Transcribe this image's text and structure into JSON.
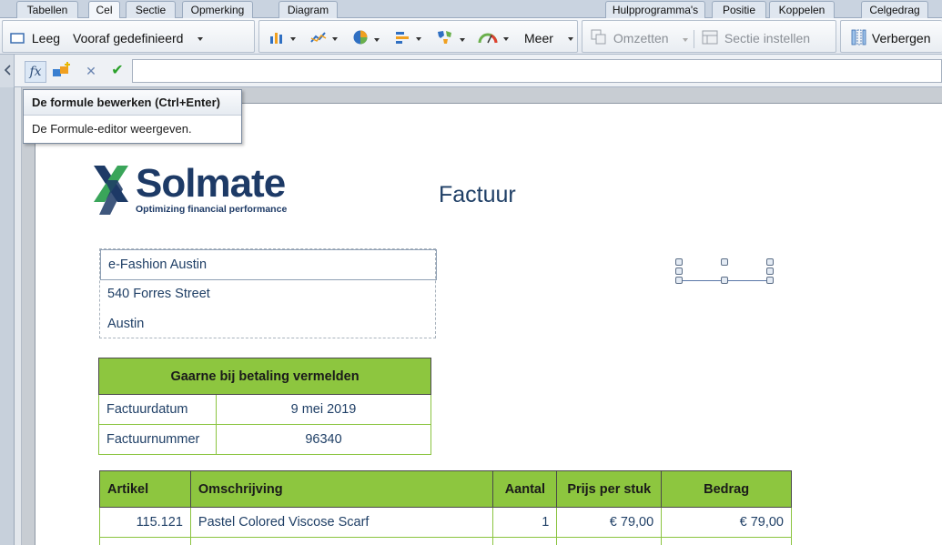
{
  "tabs_left": [
    {
      "label": "Tabellen",
      "active": false
    },
    {
      "label": "Cel",
      "active": true
    },
    {
      "label": "Sectie",
      "active": false
    },
    {
      "label": "Opmerking",
      "active": false
    },
    {
      "label": "Diagram",
      "active": false
    }
  ],
  "tabs_right": [
    {
      "label": "Hulpprogramma's",
      "active": false
    },
    {
      "label": "Positie",
      "active": false
    },
    {
      "label": "Koppelen",
      "active": false
    },
    {
      "label": "Celgedrag",
      "active": false
    }
  ],
  "toolbar": {
    "leeg_label": "Leeg",
    "vooraf_label": "Vooraf gedefinieerd",
    "meer_label": "Meer",
    "omzetten_label": "Omzetten",
    "sectie_label": "Sectie instellen",
    "verbergen_label": "Verbergen"
  },
  "formula_bar": {
    "fx_label": "fx",
    "cancel_glyph": "✕",
    "confirm_glyph": "✔",
    "input_value": ""
  },
  "tooltip": {
    "title": "De formule bewerken  (Ctrl+Enter)",
    "description": "De Formule-editor weergeven."
  },
  "report": {
    "logo_text": "Solmate",
    "logo_tagline": "Optimizing financial performance",
    "title": "Factuur",
    "address": [
      "e-Fashion Austin",
      "540 Forres Street",
      "Austin"
    ],
    "payment_header": "Gaarne bij betaling vermelden",
    "payment_rows": [
      {
        "label": "Factuurdatum",
        "value": "9 mei 2019"
      },
      {
        "label": "Factuurnummer",
        "value": "96340"
      }
    ],
    "items_headers": [
      "Artikel",
      "Omschrijving",
      "Aantal",
      "Prijs per stuk",
      "Bedrag"
    ],
    "items_rows": [
      {
        "artikel": "115.121",
        "omschrijving": "Pastel Colored Viscose Scarf",
        "aantal": "1",
        "prijs": "€ 79,00",
        "bedrag": "€ 79,00"
      }
    ]
  },
  "colors": {
    "accent_green": "#8dc63f",
    "brand_navy": "#1d3a66",
    "brand_green": "#3aa55a"
  }
}
